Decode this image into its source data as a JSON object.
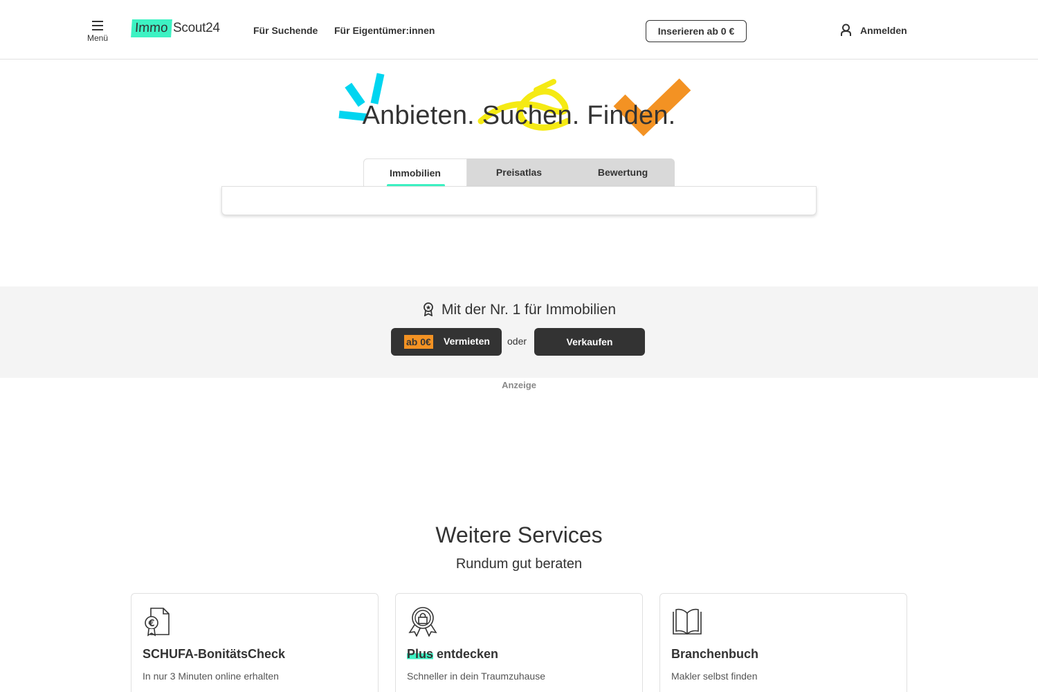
{
  "header": {
    "menu_label": "Menü",
    "logo_part1": "Immo",
    "logo_part2": "Scout24",
    "nav": {
      "suchende": "Für Suchende",
      "eigentuemer": "Für Eigentümer:innen"
    },
    "cta_label": "Inserieren ab 0 €",
    "login_label": "Anmelden"
  },
  "hero": {
    "title": "Anbieten. Suchen. Finden.",
    "tabs": [
      {
        "label": "Immobilien",
        "active": true
      },
      {
        "label": "Preisatlas",
        "active": false
      },
      {
        "label": "Bewertung",
        "active": false
      }
    ]
  },
  "promo": {
    "heading": "Mit der Nr. 1 für Immobilien",
    "badge": "ab 0€",
    "vermieten_label": "Vermieten",
    "oder": "oder",
    "verkaufen_label": "Verkaufen",
    "ad_label": "Anzeige"
  },
  "services": {
    "title": "Weitere Services",
    "subtitle": "Rundum gut beraten",
    "cards": [
      {
        "title": "SCHUFA-BonitätsCheck",
        "description": "In nur 3 Minuten online erhalten",
        "icon": "document-euro-icon"
      },
      {
        "title_highlight": "Plus",
        "title_rest": " entdecken",
        "description": "Schneller in dein Traumzuhause",
        "icon": "award-lock-icon"
      },
      {
        "title": "Branchenbuch",
        "description": "Makler selbst finden",
        "icon": "open-book-icon"
      }
    ]
  },
  "colors": {
    "accent_teal": "#3df2c3",
    "accent_orange": "#f39223",
    "accent_yellow": "#f5ea14",
    "accent_cyan": "#00d5f0",
    "dark": "#333333"
  }
}
